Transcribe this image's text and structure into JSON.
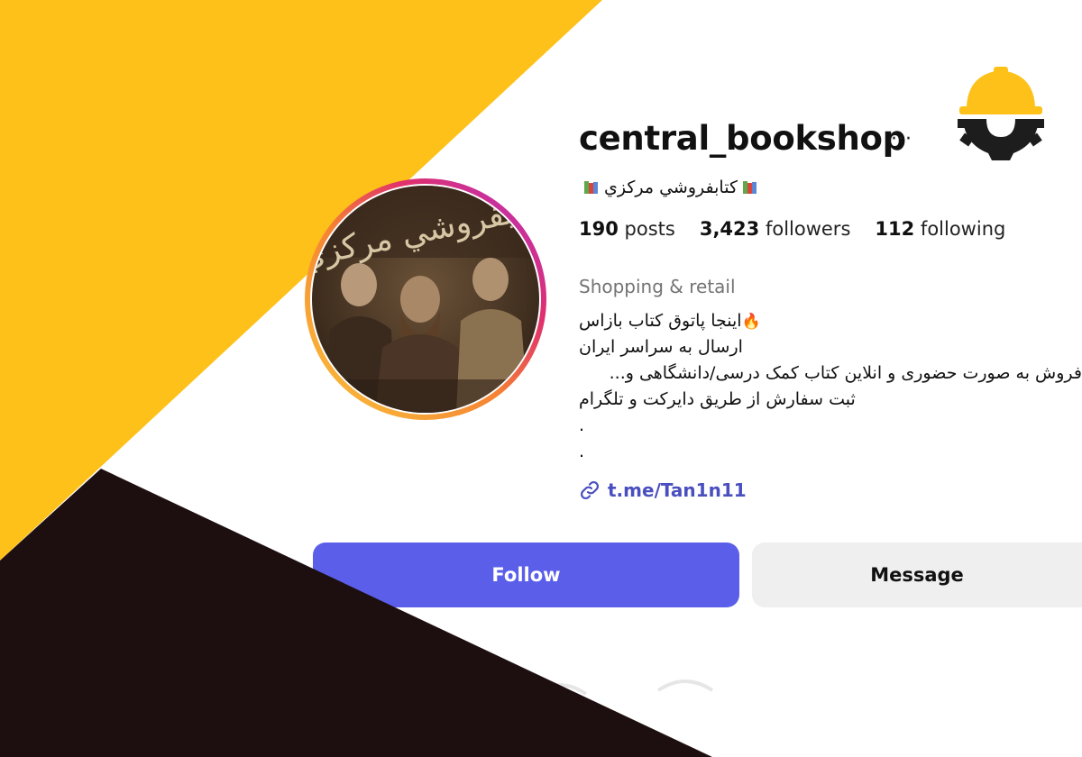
{
  "profile": {
    "username": "central_bookshop",
    "more_label": "···",
    "display_name": "كتابفروشي مركزي",
    "stats": {
      "posts_count": "190",
      "posts_label": "posts",
      "followers_count": "3,423",
      "followers_label": "followers",
      "following_count": "112",
      "following_label": "following"
    },
    "category": "Shopping & retail",
    "bio": {
      "line1": "اینجا پاتوق کتاب بازاس",
      "line1_icon": "🔥",
      "line2": "ارسال به سراسر ایران",
      "line3": "فروش به صورت حضوری و انلاین کتاب کمک درسی/دانشگاهی و...",
      "line4": "ثبت سفارش از طریق دایرکت و تلگرام",
      "line5": ".",
      "line6": "."
    },
    "link": "t.me/Tan1n11",
    "avatar_text": "كتابفروشي مركزي"
  },
  "actions": {
    "follow_label": "Follow",
    "message_label": "Message"
  },
  "colors": {
    "yellow": "#fdc11a",
    "dark": "#1d0e0f",
    "follow_blue": "#5b5ee9",
    "link_blue": "#4a4fbf",
    "category_gray": "#737373"
  },
  "icons": {
    "more": "ellipsis-icon",
    "books": "books-emoji-icon",
    "flame": "fire-emoji-icon",
    "link": "link-icon",
    "logo": "construction-helmet-gear-logo"
  }
}
